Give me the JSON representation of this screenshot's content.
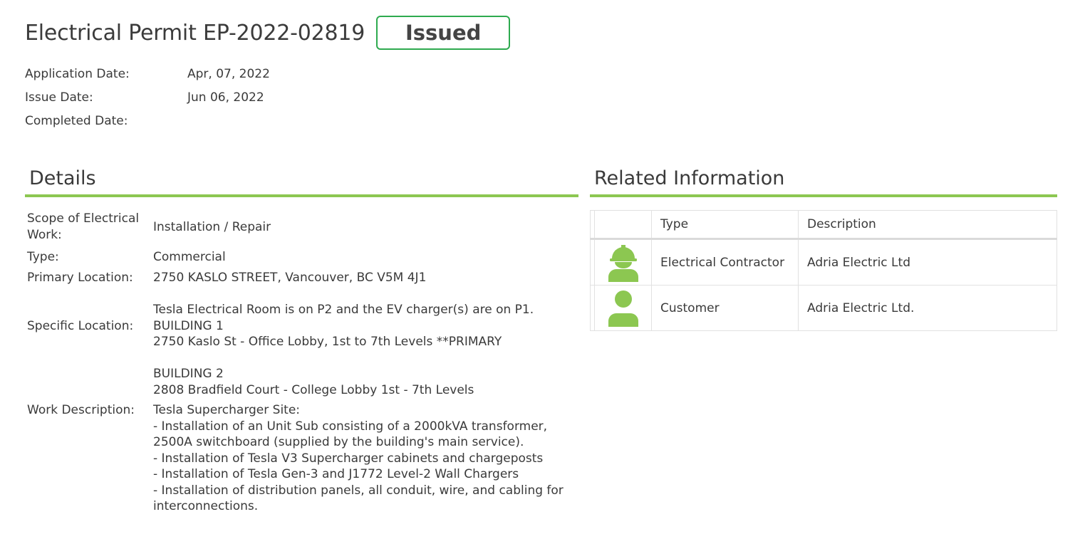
{
  "permit": {
    "title": "Electrical Permit EP-2022-02819",
    "status": "Issued",
    "status_color": "#2eaa4f"
  },
  "dates": [
    {
      "label": "Application Date:",
      "value": "Apr, 07, 2022"
    },
    {
      "label": "Issue Date:",
      "value": "Jun 06, 2022"
    },
    {
      "label": "Completed Date:",
      "value": ""
    }
  ],
  "sections": {
    "details": "Details",
    "related": "Related Information",
    "accent_color": "#8cc751"
  },
  "details": {
    "scope": {
      "label": "Scope of Electrical Work:",
      "value": "Installation / Repair"
    },
    "type": {
      "label": "Type:",
      "value": "Commercial"
    },
    "primary_location": {
      "label": "Primary Location:",
      "value": "2750 KASLO STREET, Vancouver, BC V5M 4J1"
    },
    "specific_location": {
      "label": "Specific Location:",
      "value": "Tesla Electrical Room is on P2 and the EV charger(s) are on P1.\nBUILDING 1\n2750 Kaslo St - Office Lobby, 1st to 7th Levels **PRIMARY\n\nBUILDING 2\n2808 Bradfield Court - College Lobby 1st - 7th Levels"
    },
    "work_description": {
      "label": "Work Description:",
      "value": "Tesla Supercharger Site:\n- Installation of an Unit Sub consisting of a 2000kVA transformer, 2500A switchboard (supplied by the building's main service).\n- Installation of Tesla V3 Supercharger cabinets and chargeposts\n- Installation of Tesla Gen-3 and J1772 Level-2 Wall Chargers\n- Installation of distribution panels, all conduit, wire, and cabling for interconnections."
    }
  },
  "related": {
    "columns": [
      "Type",
      "Description"
    ],
    "rows": [
      {
        "icon": "contractor-hardhat-icon",
        "type": "Electrical Contractor",
        "description": "Adria Electric Ltd"
      },
      {
        "icon": "customer-person-icon",
        "type": "Customer",
        "description": "Adria Electric Ltd."
      }
    ],
    "icon_color": "#8cc751"
  }
}
